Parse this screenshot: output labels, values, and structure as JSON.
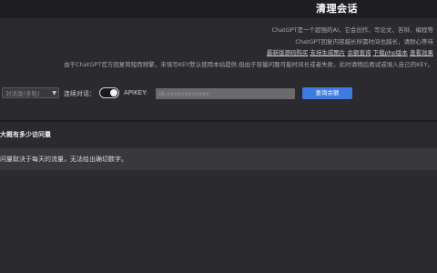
{
  "header": {
    "title": "清理会话"
  },
  "info": {
    "line1": "ChatGPT是一个超强的AI，它会创作、写论文、答辩、编程等",
    "line2": "ChatGPT回复内容越长所需时间也越长，请耐心等待",
    "links": [
      "最新版源码购买",
      "支持生成图片",
      "余额查询",
      "下载php版本",
      "查看效果"
    ],
    "line4": "由于ChatGPT官方回复简短而频繁，未填写KEY默认使用本站提供,但由于容量问题可能时间长或者失败，此时请稍后再试或填入自己的KEY。"
  },
  "controls": {
    "mode_select": "对话版(多轮)",
    "continuous_label": "连续对话：",
    "apikey_label": "APIKEY:",
    "apikey_placeholder": "sk-xxxxxxxxxxxx",
    "query_button": "查询余额"
  },
  "chat": {
    "question": "大概有多少访问量",
    "answer": "问量取决于每天的流量，无法给出确切数字。"
  },
  "colors": {
    "accent": "#3d7be0",
    "background": "#2b2b2f"
  }
}
